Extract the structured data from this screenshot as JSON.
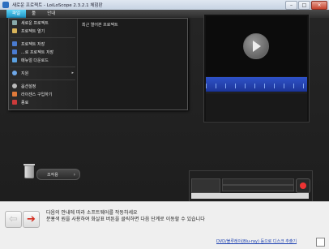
{
  "window": {
    "title": "새로운 프로젝트 - LoiLoScope 2.3.2.1 체험판",
    "controls": {
      "minimize": "–",
      "maximize": "□",
      "close": "×"
    }
  },
  "menubar": {
    "tabs": [
      {
        "label": "파일",
        "active": true
      },
      {
        "label": "툴"
      },
      {
        "label": "안내"
      }
    ]
  },
  "file_menu": {
    "items": [
      {
        "label": "새로운 프로젝트",
        "icon": "new-project-icon"
      },
      {
        "label": "프로젝트 열기",
        "icon": "open-folder-icon"
      },
      {
        "label": "프로젝트 저장",
        "icon": "save-icon"
      },
      {
        "label": "...로 프로젝트 저장",
        "icon": "save-as-icon"
      },
      {
        "label": "매뉴얼 다운로드",
        "icon": "download-manual-icon"
      },
      {
        "label": "지원",
        "icon": "help-icon",
        "submenu": "▸"
      },
      {
        "label": "옵션설정",
        "icon": "settings-icon"
      },
      {
        "label": "라이센스 구입하기",
        "icon": "cart-icon"
      },
      {
        "label": "종료",
        "icon": "exit-icon"
      }
    ],
    "recent_title": "최근 열어본 프로젝트"
  },
  "trash": {
    "label": "조작용",
    "chevron": "›"
  },
  "bottom": {
    "back_arrow": "⇦",
    "next_arrow": "➔",
    "help_line1": "다음의 안내에 따라 소프트웨어를 작동하세요",
    "help_line2": "분홍색 원을 사용하여 화살표 버튼을 클릭하면 다음 단계로 이동할 수 있습니다",
    "dvd_link": "DVD/블루레이(Blu-ray) 등으로 디스크 추출기"
  },
  "accent": "#1e94c6"
}
